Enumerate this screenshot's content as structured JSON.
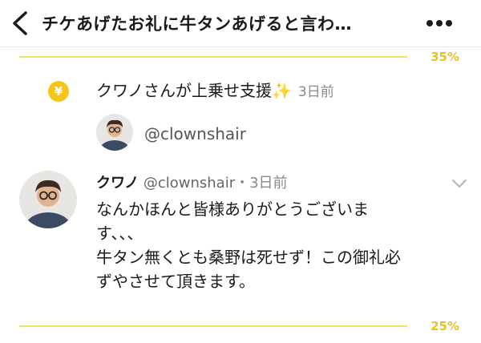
{
  "header": {
    "title": "チケあげたお礼に牛タンあげると言わ…"
  },
  "progress_top": {
    "percent_label": "35%",
    "value": 35
  },
  "support": {
    "icon_symbol": "¥",
    "text": "クワノさんが上乗せ支援",
    "sparkle": "✨",
    "time": "3日前",
    "handle": "@clownshair"
  },
  "reply": {
    "name": "クワノ",
    "handle": "@clownshair",
    "separator": "・",
    "time": "3日前",
    "body_lines": [
      "なんかほんと皆様ありがとうございま",
      "す、、、",
      "牛タン無くとも桑野は死せず！この御礼必",
      "ずやさせて頂きます。"
    ]
  },
  "progress_bottom": {
    "percent_label": "25%",
    "value": 25
  },
  "colors": {
    "accent": "#f5c518",
    "bar": "#f3df63",
    "percent_text": "#e4c327"
  }
}
